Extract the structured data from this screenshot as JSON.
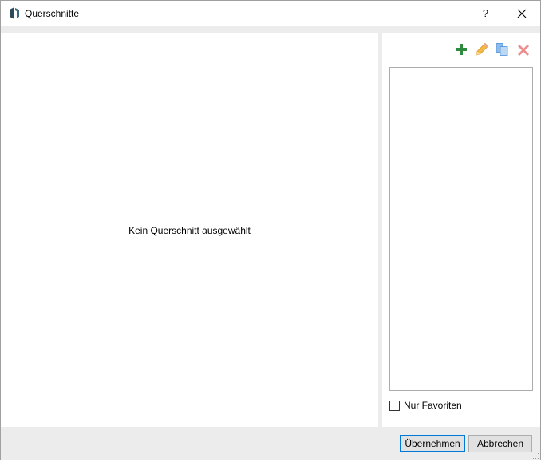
{
  "window": {
    "title": "Querschnitte",
    "help_glyph": "?",
    "close_glyph": "✕"
  },
  "main": {
    "empty_message": "Kein Querschnitt ausgewählt"
  },
  "sidebar": {
    "toolbar": [
      {
        "icon": "plus-icon",
        "color": "#2e8b3d"
      },
      {
        "icon": "pencil-icon",
        "color": "#f5a623"
      },
      {
        "icon": "copy-icon",
        "color": "#4a90d9"
      },
      {
        "icon": "delete-icon",
        "color": "#e87c7c"
      }
    ],
    "favorites_label": "Nur Favoriten",
    "favorites_checked": false
  },
  "footer": {
    "apply_label": "Übernehmen",
    "cancel_label": "Abbrechen"
  },
  "colors": {
    "accent": "#0078d7",
    "chrome": "#ececec"
  }
}
